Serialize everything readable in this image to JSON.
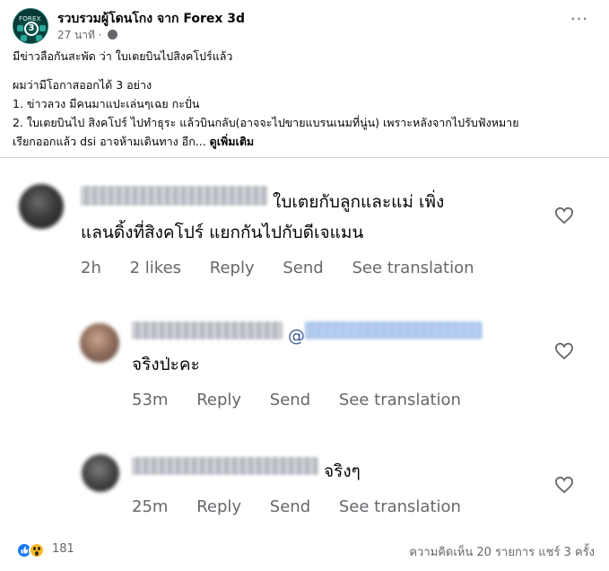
{
  "post": {
    "page_name": "รวบรวมผู้โดนโกง จาก Forex 3d",
    "time": "27 นาที",
    "avatar_brand": "FOREX",
    "avatar_mark": "3",
    "body": {
      "line1": "มีข่าวลือกันสะพัด ว่า ใบเตยบินไปสิงคโปร์แล้ว",
      "line2": "ผมว่ามีโอกาสออกได้ 3 อย่าง",
      "line3": "1. ข่าวลวง มีคนมาแปะเล่นๆเฉย กะปั่น",
      "line4": "2. ใบเตยบินไป สิงคโปร์ ไปทำธุระ แล้วบินกลับ(อาจจะไปขายแบรนเนมที่นู่น) เพราะหลังจากไปรับฟังหมาย",
      "line5": "เรียกออกแล้ว dsi อาจห้ามเดินทาง อีก...",
      "see_more": "ดูเพิ่มเติม"
    }
  },
  "comments": [
    {
      "text_line1": "ใบเตยกับลูกและแม่ เพิ่ง",
      "text_line2": "แลนดิ้งที่สิงคโปร์ แยกกันไปกับดีเจแมน",
      "time": "2h",
      "likes": "2 likes",
      "reply": "Reply",
      "send": "Send",
      "translate": "See translation"
    },
    {
      "mention_at": "@",
      "text": "จริงป่ะคะ",
      "time": "53m",
      "reply": "Reply",
      "send": "Send",
      "translate": "See translation"
    },
    {
      "text": "จริงๆ",
      "time": "25m",
      "reply": "Reply",
      "send": "Send",
      "translate": "See translation"
    }
  ],
  "footer": {
    "reaction_count": "181",
    "stats": "ความคิดเห็น 20 รายการ  แชร์ 3 ครั้ง",
    "reaction_icons": [
      "like-icon",
      "wow-icon"
    ]
  },
  "colors": {
    "secondary_text": "#65676b",
    "like_blue": "#1877f2",
    "wow_yellow": "#f7b928"
  }
}
